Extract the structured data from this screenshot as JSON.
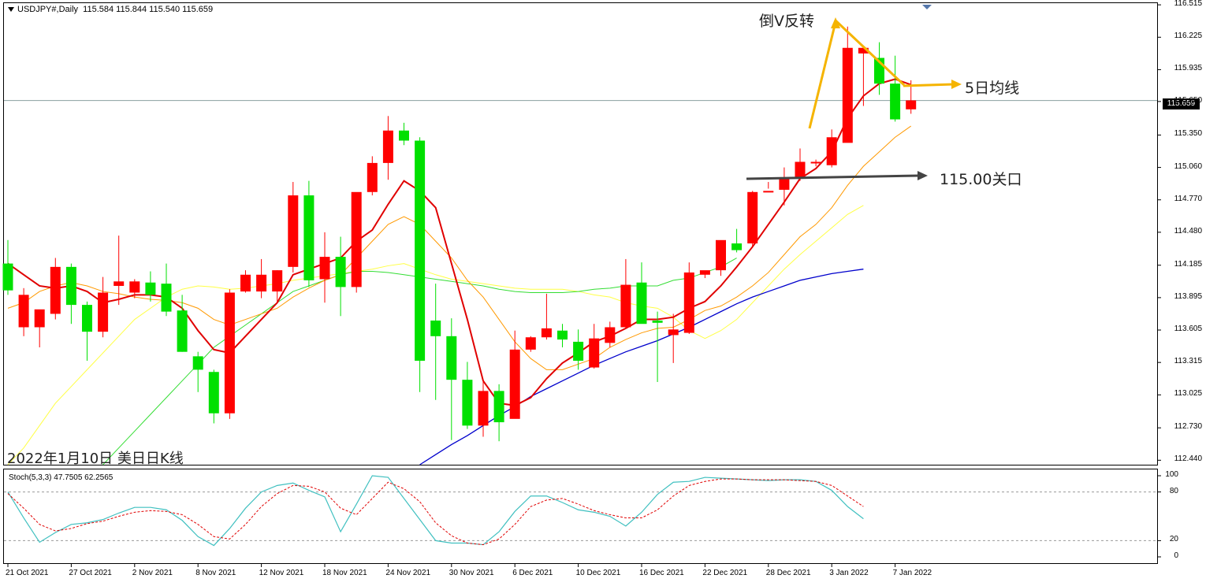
{
  "header": {
    "symbol": "USDJPY#,Daily",
    "ohlc": "115.584 115.844 115.540 115.659"
  },
  "stoch_label": "Stoch(5,3,3) 47.7505 62.2565",
  "annotations": {
    "inverted_v": "倒V反转",
    "ma5": "5日均线",
    "level": "115.00关口",
    "caption": "2022年1月10日 美日日K线"
  },
  "current_price": "115.659",
  "colors": {
    "up": "#ff0000",
    "down": "#00e000",
    "ma5": "#e00000",
    "ma10": "#ff9900",
    "ma20": "#ffff44",
    "ma30": "#33dd33",
    "ma60": "#0000cc",
    "stoch_main": "#40c0c0",
    "stoch_signal": "#e00000",
    "arrow_gold": "#f5b400",
    "arrow_dark": "#444444"
  },
  "chart_data": {
    "type": "candlestick",
    "title": "USDJPY#,Daily",
    "y_ticks": [
      "116.515",
      "116.225",
      "115.935",
      "115.650",
      "115.350",
      "115.060",
      "114.770",
      "114.480",
      "114.185",
      "113.895",
      "113.605",
      "113.315",
      "113.025",
      "112.730",
      "112.440"
    ],
    "ylim": [
      112.4,
      116.53
    ],
    "x_ticks": [
      "21 Oct 2021",
      "27 Oct 2021",
      "2 Nov 2021",
      "8 Nov 2021",
      "12 Nov 2021",
      "18 Nov 2021",
      "24 Nov 2021",
      "30 Nov 2021",
      "6 Dec 2021",
      "10 Dec 2021",
      "16 Dec 2021",
      "22 Dec 2021",
      "28 Dec 2021",
      "3 Jan 2022",
      "7 Jan 2022"
    ],
    "x_tick_index": [
      0,
      4,
      8,
      12,
      16,
      20,
      24,
      28,
      32,
      36,
      40,
      44,
      48,
      52,
      56
    ],
    "candles": [
      [
        114.2,
        114.41,
        113.92,
        113.96
      ],
      [
        113.63,
        113.98,
        113.55,
        113.92
      ],
      [
        113.63,
        113.71,
        113.45,
        113.79
      ],
      [
        113.75,
        114.25,
        113.7,
        114.17
      ],
      [
        114.17,
        114.2,
        113.66,
        113.83
      ],
      [
        113.83,
        113.86,
        113.33,
        113.59
      ],
      [
        113.59,
        114.08,
        113.54,
        113.94
      ],
      [
        114.0,
        114.45,
        113.83,
        114.04
      ],
      [
        113.94,
        114.06,
        113.89,
        114.04
      ],
      [
        114.03,
        114.13,
        113.86,
        113.92
      ],
      [
        114.02,
        114.2,
        113.73,
        113.77
      ],
      [
        113.78,
        113.92,
        113.41,
        113.41
      ],
      [
        113.37,
        113.41,
        113.05,
        113.25
      ],
      [
        113.23,
        113.25,
        112.77,
        112.86
      ],
      [
        112.86,
        113.97,
        112.81,
        113.94
      ],
      [
        113.95,
        114.14,
        113.94,
        114.1
      ],
      [
        113.95,
        114.24,
        113.89,
        114.1
      ],
      [
        113.95,
        114.14,
        113.85,
        114.14
      ],
      [
        114.17,
        114.93,
        114.12,
        114.81
      ],
      [
        114.81,
        114.94,
        113.99,
        114.05
      ],
      [
        114.06,
        114.48,
        113.85,
        114.26
      ],
      [
        114.26,
        114.44,
        113.73,
        113.99
      ],
      [
        113.99,
        114.79,
        113.94,
        114.84
      ],
      [
        114.84,
        115.16,
        114.81,
        115.1
      ],
      [
        115.1,
        115.52,
        114.95,
        115.39
      ],
      [
        115.39,
        115.46,
        115.26,
        115.3
      ],
      [
        115.3,
        115.33,
        113.05,
        113.33
      ],
      [
        113.69,
        114.02,
        112.98,
        113.55
      ],
      [
        113.55,
        113.71,
        112.62,
        113.16
      ],
      [
        113.16,
        113.32,
        112.72,
        112.75
      ],
      [
        112.75,
        113.15,
        112.65,
        113.06
      ],
      [
        113.06,
        113.12,
        112.61,
        112.78
      ],
      [
        112.81,
        113.6,
        112.82,
        113.43
      ],
      [
        113.43,
        113.55,
        113.41,
        113.54
      ],
      [
        113.54,
        113.93,
        113.52,
        113.62
      ],
      [
        113.6,
        113.66,
        113.45,
        113.52
      ],
      [
        113.5,
        113.61,
        113.25,
        113.33
      ],
      [
        113.27,
        113.66,
        113.26,
        113.53
      ],
      [
        113.49,
        113.68,
        113.45,
        113.63
      ],
      [
        113.63,
        114.24,
        113.62,
        114.01
      ],
      [
        114.03,
        114.21,
        113.7,
        113.66
      ],
      [
        113.69,
        113.77,
        113.14,
        113.67
      ],
      [
        113.56,
        113.75,
        113.31,
        113.61
      ],
      [
        113.58,
        114.21,
        113.57,
        114.12
      ],
      [
        114.1,
        114.12,
        114.07,
        114.14
      ],
      [
        114.14,
        114.38,
        114.09,
        114.41
      ],
      [
        114.38,
        114.51,
        114.3,
        114.32
      ],
      [
        114.38,
        114.85,
        114.35,
        114.84
      ],
      [
        114.84,
        114.93,
        114.87,
        114.85
      ],
      [
        114.86,
        115.06,
        114.72,
        114.97
      ],
      [
        114.97,
        115.23,
        114.94,
        115.11
      ],
      [
        115.11,
        115.13,
        115.07,
        115.11
      ],
      [
        115.08,
        115.4,
        115.06,
        115.33
      ],
      [
        115.28,
        116.32,
        115.29,
        116.13
      ],
      [
        116.08,
        116.12,
        115.61,
        116.13
      ],
      [
        116.04,
        116.18,
        115.71,
        115.81
      ],
      [
        115.81,
        116.06,
        115.47,
        115.49
      ],
      [
        115.58,
        115.84,
        115.54,
        115.66
      ]
    ],
    "ma5": [
      114.2,
      114.1,
      114.0,
      113.98,
      114.0,
      113.95,
      113.85,
      113.88,
      113.92,
      113.92,
      113.9,
      113.8,
      113.6,
      113.43,
      113.4,
      113.55,
      113.7,
      113.85,
      114.1,
      114.15,
      114.2,
      114.25,
      114.4,
      114.5,
      114.73,
      114.94,
      114.85,
      114.7,
      114.2,
      113.7,
      113.15,
      112.95,
      112.93,
      113.0,
      113.17,
      113.31,
      113.4,
      113.5,
      113.55,
      113.62,
      113.7,
      113.7,
      113.72,
      113.8,
      113.86,
      114.0,
      114.17,
      114.35,
      114.55,
      114.75,
      114.96,
      115.05,
      115.2,
      115.5,
      115.7,
      115.81,
      115.85,
      115.8
    ],
    "ma10": [
      113.8,
      113.85,
      113.95,
      114.0,
      114.03,
      114.0,
      113.95,
      113.93,
      113.9,
      113.88,
      113.87,
      113.85,
      113.8,
      113.7,
      113.65,
      113.7,
      113.75,
      113.8,
      113.9,
      113.98,
      114.05,
      114.1,
      114.25,
      114.4,
      114.55,
      114.62,
      114.55,
      114.4,
      114.25,
      114.05,
      113.9,
      113.7,
      113.5,
      113.35,
      113.25,
      113.25,
      113.3,
      113.35,
      113.45,
      113.52,
      113.58,
      113.62,
      113.63,
      113.7,
      113.78,
      113.82,
      113.9,
      114.0,
      114.12,
      114.28,
      114.44,
      114.55,
      114.7,
      114.9,
      115.07,
      115.2,
      115.33,
      115.43
    ],
    "ma20": [
      112.4,
      112.55,
      112.75,
      112.95,
      113.1,
      113.25,
      113.4,
      113.55,
      113.7,
      113.8,
      113.9,
      113.97,
      114.0,
      113.99,
      113.97,
      113.98,
      114.0,
      114.02,
      114.05,
      114.07,
      114.09,
      114.11,
      114.13,
      114.15,
      114.18,
      114.2,
      114.15,
      114.1,
      114.06,
      114.04,
      114.02,
      114.0,
      113.98,
      113.97,
      113.97,
      113.97,
      113.95,
      113.92,
      113.9,
      113.85,
      113.82,
      113.8,
      113.72,
      113.6,
      113.53,
      113.6,
      113.7,
      113.85,
      114.0,
      114.15,
      114.28,
      114.4,
      114.52,
      114.64,
      114.72
    ],
    "ma20_start": 0,
    "ma30": [
      112.4,
      112.55,
      112.7,
      112.85,
      113.0,
      113.15,
      113.3,
      113.45,
      113.55,
      113.65,
      113.75,
      113.85,
      113.95,
      114.0,
      114.05,
      114.1,
      114.13,
      114.13,
      114.12,
      114.1,
      114.08,
      114.06,
      114.04,
      114.02,
      114.0,
      113.97,
      113.95,
      113.94,
      113.94,
      113.94,
      113.95,
      113.97,
      113.98,
      114.0,
      114.0,
      114.0,
      114.05,
      114.07,
      114.12,
      114.17,
      114.25
    ],
    "ma30_start": 6,
    "ma60": [
      112.4,
      112.49,
      112.58,
      112.66,
      112.75,
      112.84,
      112.92,
      113.01,
      113.08,
      113.15,
      113.22,
      113.29,
      113.35,
      113.41,
      113.46,
      113.51,
      113.57,
      113.63,
      113.7,
      113.77,
      113.84,
      113.9,
      113.95,
      114.0,
      114.05,
      114.08,
      114.11,
      114.13,
      114.15
    ],
    "ma60_start": 26,
    "stoch_ylim": [
      0,
      100
    ],
    "stoch_ticks": [
      100,
      80,
      20,
      0
    ],
    "stoch_main": [
      80,
      48,
      18,
      30,
      40,
      42,
      46,
      54,
      61,
      61,
      58,
      45,
      25,
      14,
      35,
      60,
      80,
      88,
      91,
      82,
      74,
      31,
      65,
      100,
      98,
      72,
      46,
      20,
      17,
      17,
      15,
      31,
      56,
      75,
      75,
      67,
      58,
      55,
      50,
      38,
      55,
      77,
      92,
      93,
      98,
      97,
      96,
      95,
      94,
      95,
      95,
      93,
      82,
      62,
      47
    ],
    "stoch_signal": [
      78,
      60,
      40,
      32,
      35,
      41,
      44,
      50,
      55,
      57,
      56,
      52,
      40,
      25,
      22,
      40,
      62,
      78,
      88,
      87,
      80,
      60,
      52,
      72,
      92,
      84,
      68,
      42,
      26,
      17,
      15,
      22,
      40,
      62,
      70,
      72,
      65,
      57,
      52,
      48,
      48,
      58,
      75,
      88,
      93,
      96,
      96,
      95,
      95,
      95,
      94,
      93,
      88,
      75,
      62
    ]
  }
}
